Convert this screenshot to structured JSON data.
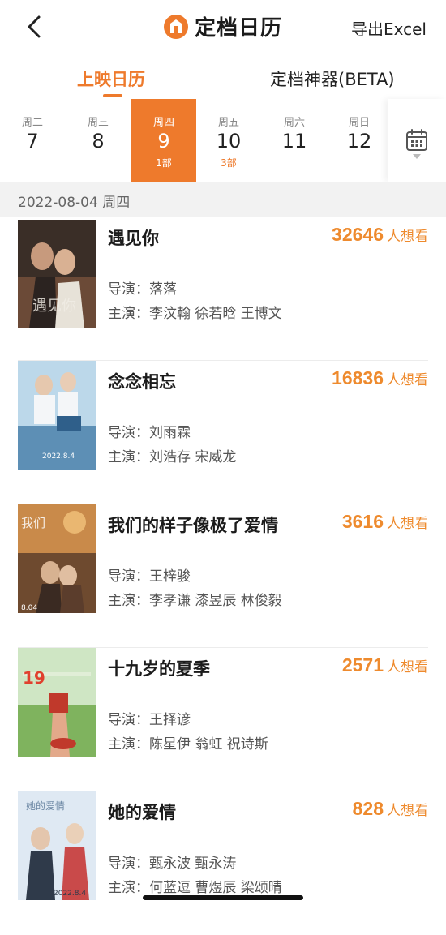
{
  "nav": {
    "title": "定档日历",
    "export_label": "导出Excel"
  },
  "tabs": [
    {
      "label": "上映日历",
      "active": true
    },
    {
      "label": "定档神器(BETA)",
      "active": false
    }
  ],
  "week": [
    {
      "weekday": "周二",
      "day": "7",
      "count": ""
    },
    {
      "weekday": "周三",
      "day": "8",
      "count": ""
    },
    {
      "weekday": "周四",
      "day": "9",
      "count": "1部",
      "selected": true
    },
    {
      "weekday": "周五",
      "day": "10",
      "count": "3部"
    },
    {
      "weekday": "周六",
      "day": "11",
      "count": ""
    },
    {
      "weekday": "周日",
      "day": "12",
      "count": ""
    }
  ],
  "date_header": "2022-08-04 周四",
  "colors": {
    "accent": "#ee7a2c",
    "want_number": "#ee8a2d"
  },
  "movies": [
    {
      "title": "遇见你",
      "want_count": "32646",
      "want_suffix": "人想看",
      "director": "导演：落落",
      "cast": "主演：李汶翰 徐若晗 王博文"
    },
    {
      "title": "念念相忘",
      "want_count": "16836",
      "want_suffix": "人想看",
      "director": "导演：刘雨霖",
      "cast": "主演：刘浩存 宋威龙"
    },
    {
      "title": "我们的样子像极了爱情",
      "want_count": "3616",
      "want_suffix": "人想看",
      "director": "导演：王梓骏",
      "cast": "主演：李孝谦 漆昱辰 林俊毅"
    },
    {
      "title": "十九岁的夏季",
      "want_count": "2571",
      "want_suffix": "人想看",
      "director": "导演：王择谚",
      "cast": "主演：陈星伊 翁虹 祝诗斯"
    },
    {
      "title": "她的爱情",
      "want_count": "828",
      "want_suffix": "人想看",
      "director": "导演：甄永波 甄永涛",
      "cast": "主演：何蓝逗 曹煜辰 梁颂晴"
    }
  ]
}
